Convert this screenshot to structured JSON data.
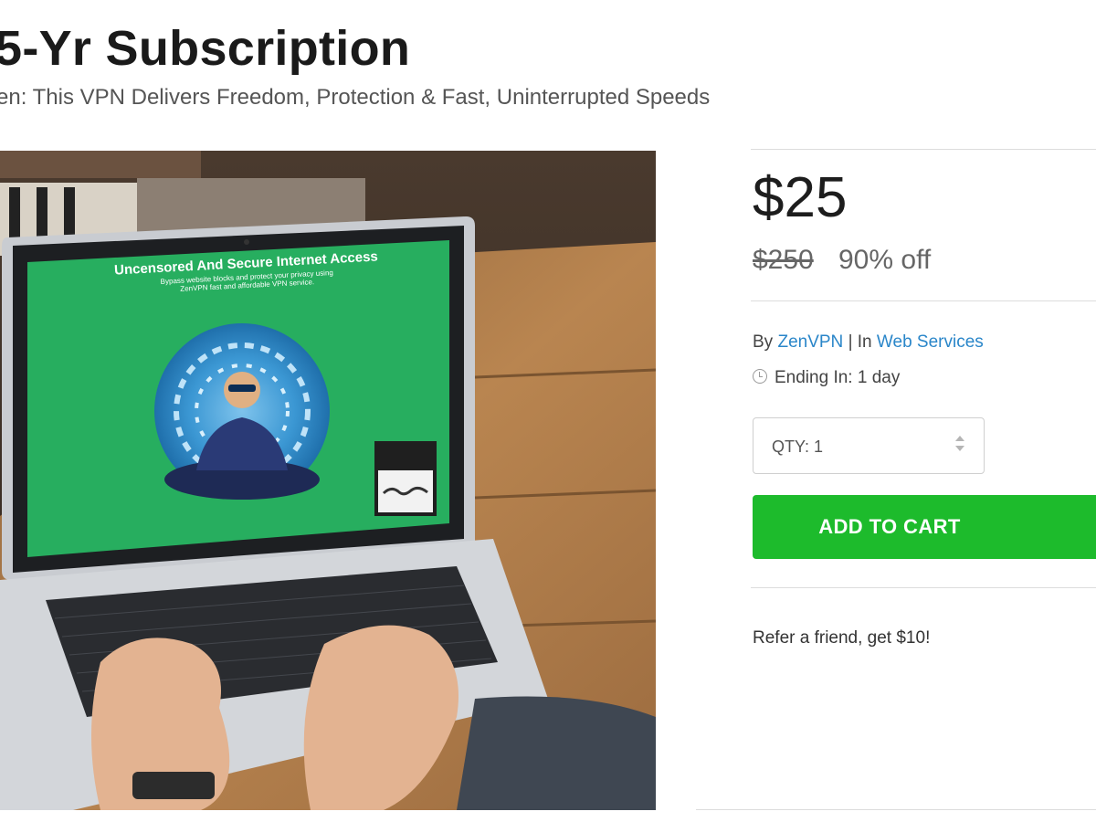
{
  "product": {
    "title": "5-Yr Subscription",
    "subtitle": "en: This VPN Delivers Freedom, Protection & Fast, Uninterrupted Speeds"
  },
  "hero_screen": {
    "headline": "Uncensored And Secure Internet Access",
    "line1": "Bypass website blocks and protect your privacy using",
    "line2": "ZenVPN fast and affordable VPN service.",
    "accent_color": "#27ae5f"
  },
  "pricing": {
    "price": "$25",
    "original_price": "$250",
    "discount": "90% off"
  },
  "meta": {
    "by_label": "By",
    "vendor": "ZenVPN",
    "separator": "|",
    "in_label": "In",
    "category": "Web Services",
    "ending_label": "Ending In: 1 day"
  },
  "qty": {
    "label": "QTY: 1"
  },
  "cart": {
    "label": "ADD TO CART",
    "color": "#1dbb2c"
  },
  "referral": {
    "text": "Refer a friend, get $10!"
  }
}
